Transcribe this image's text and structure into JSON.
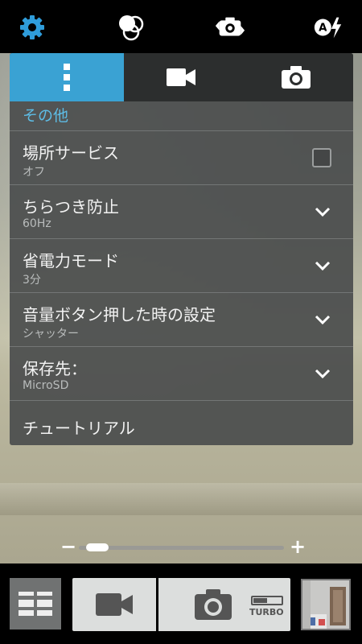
{
  "top_icons": [
    "settings-gear-icon",
    "color-effects-icon",
    "switch-camera-icon",
    "auto-flash-icon"
  ],
  "tabs": [
    {
      "icon": "more-vertical-icon",
      "active": true
    },
    {
      "icon": "video-camera-icon",
      "active": false
    },
    {
      "icon": "camera-icon",
      "active": false
    }
  ],
  "section_title": "その他",
  "settings": [
    {
      "title": "場所サービス",
      "value": "オフ",
      "control": "checkbox",
      "checked": false
    },
    {
      "title": "ちらつき防止",
      "value": "60Hz",
      "control": "dropdown"
    },
    {
      "title": "省電力モード",
      "value": "3分",
      "control": "dropdown"
    },
    {
      "title": "音量ボタン押した時の設定",
      "value": "シャッター",
      "control": "dropdown"
    },
    {
      "title": "保存先：",
      "value": "MicroSD",
      "control": "dropdown"
    },
    {
      "title": "チュートリアル",
      "value": "",
      "control": "none"
    }
  ],
  "zoom": {
    "minus": "−",
    "plus": "+",
    "level": 0.05
  },
  "bottom": {
    "turbo_label": "TURBO",
    "turbo_level": 0.5,
    "mode_icon": "camera-mode-grid-icon",
    "video_icon": "video-record-icon",
    "shutter_icon": "camera-shutter-icon",
    "gallery": "gallery-thumbnail"
  },
  "colors": {
    "accent": "#3aa2d3",
    "section_title": "#5dbde6"
  }
}
